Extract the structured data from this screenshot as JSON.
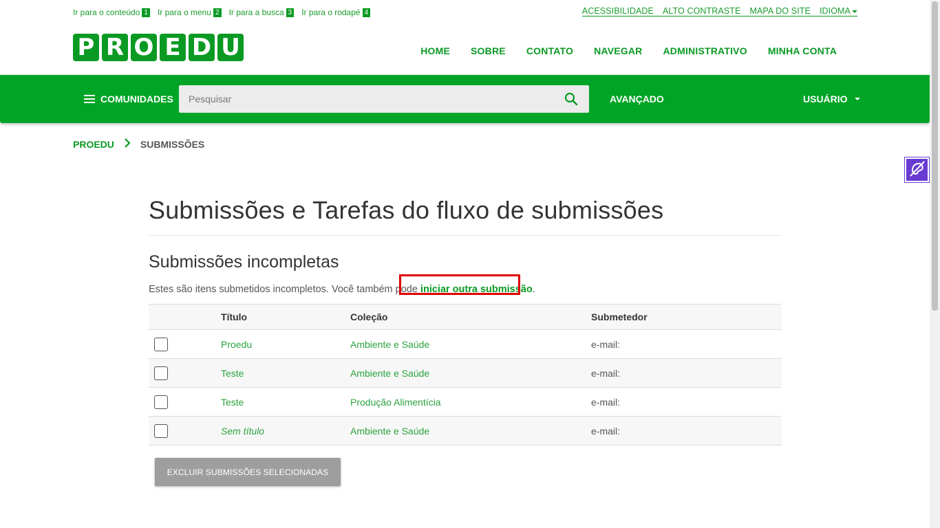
{
  "skip_links": [
    {
      "label": "Ir para o conteúdo",
      "key": "1"
    },
    {
      "label": "Ir para o menu",
      "key": "2"
    },
    {
      "label": "Ir para a busca",
      "key": "3"
    },
    {
      "label": "Ir para o rodapé",
      "key": "4"
    }
  ],
  "access_links": [
    "ACESSIBILIDADE",
    "ALTO CONTRASTE",
    "MAPA DO SITE",
    "IDIOMA"
  ],
  "logo_letters": [
    "P",
    "R",
    "O",
    "E",
    "D",
    "U"
  ],
  "main_nav": [
    "HOME",
    "SOBRE",
    "CONTATO",
    "NAVEGAR",
    "ADMINISTRATIVO",
    "MINHA CONTA"
  ],
  "toolbar": {
    "communities_label": "COMUNIDADES",
    "search_placeholder": "Pesquisar",
    "advanced_label": "AVANÇADO",
    "user_label": "USUÁRIO"
  },
  "breadcrumb": {
    "root": "PROEDU",
    "current": "SUBMISSÕES"
  },
  "page": {
    "title": "Submissões e Tarefas do fluxo de submissões",
    "section_title": "Submissões incompletas",
    "intro_text": "Estes são itens submetidos incompletos. Você também pode ",
    "intro_link": "iniciar outra submissão",
    "intro_end": "."
  },
  "table": {
    "headers": [
      "Título",
      "Coleção",
      "Submetedor"
    ],
    "rows": [
      {
        "title": "Proedu",
        "collection": "Ambiente e Saúde",
        "submitter": "e-mail:",
        "italic": false
      },
      {
        "title": "Teste",
        "collection": "Ambiente e Saúde",
        "submitter": "e-mail:",
        "italic": false
      },
      {
        "title": "Teste",
        "collection": "Produção Alimentícia",
        "submitter": "e-mail:",
        "italic": false
      },
      {
        "title": "Sem título",
        "collection": "Ambiente e Saúde",
        "submitter": "e-mail:",
        "italic": true
      }
    ]
  },
  "delete_button": "EXCLUIR SUBMISSÕES SELECIONADAS",
  "colors": {
    "brand_green": "#00a426",
    "link_green": "#0a9a23",
    "highlight_red": "#e00000",
    "vlibras_purple": "#6a3bd2"
  },
  "icons": {
    "search": "search-icon",
    "menu": "hamburger-menu-icon",
    "vlibras": "hand-sign-language-icon",
    "breadcrumb_separator": "chevron-right-icon"
  }
}
